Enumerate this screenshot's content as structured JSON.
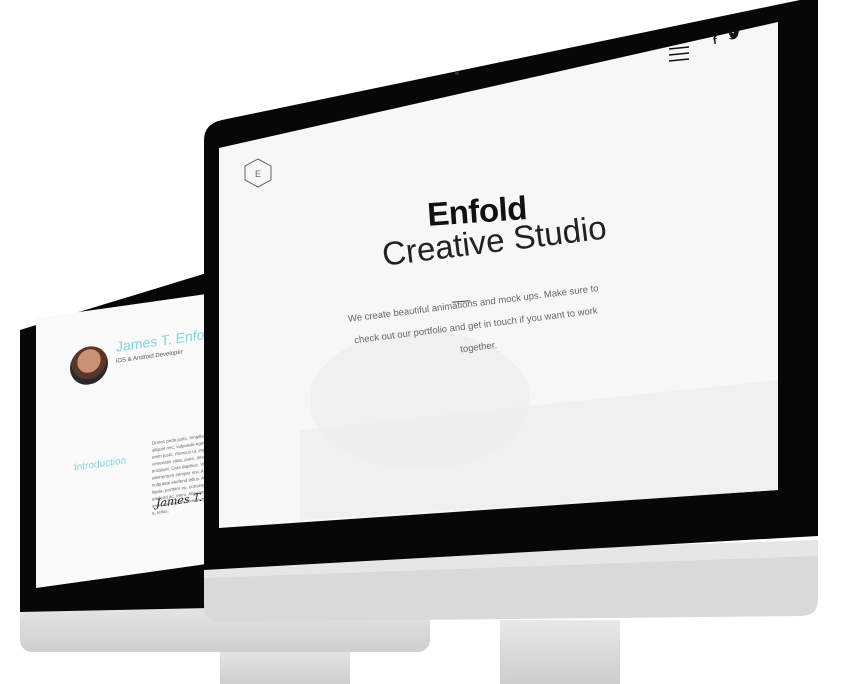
{
  "back_site": {
    "name": "James T. Enfold",
    "role": "iOS & Android Developer",
    "section_label": "Introduction",
    "intro_text": "Donec pede justo, fringilla vel, aliquet nec, vulputate eget, arcu. In enim justo, rhoncus ut, imperdiet a, venenatis vitae, justo. Integer tincidunt. Cras dapibus. Vivamus elementum semper nisi. Aenean vulputate eleifend tellus. Aenean leo ligula, porttitor eu, consequat vitae, eleifend ac, enim. Aliquam lorem ante, dapibus in, viverra quis, feugiat a, tellus.",
    "signature": "James T. Enfold"
  },
  "front_site": {
    "title": "Enfold",
    "subtitle": "Creative Studio",
    "description": "We create beautiful animations and mock ups. Make sure to check out our portfolio and get in touch if you want to work together.",
    "logo_letter": "E",
    "social": {
      "facebook": "f"
    },
    "icons": [
      "hexagon-logo-icon",
      "hamburger-menu-icon",
      "facebook-icon",
      "twitter-icon"
    ]
  },
  "colors": {
    "accent": "#7fd6de",
    "bezel": "#070707",
    "aluminum": "#d4d4d4"
  }
}
